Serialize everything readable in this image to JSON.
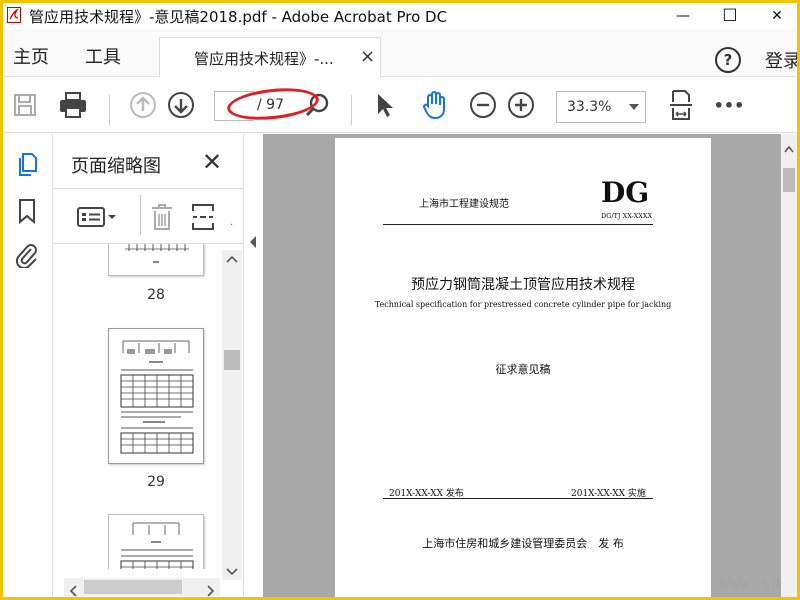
{
  "window": {
    "title": "管应用技术规程》-意见稿2018.pdf - Adobe Acrobat Pro DC",
    "minimize_glyph": "—",
    "maximize_glyph": "☐",
    "close_glyph": "✕"
  },
  "tabs": {
    "home_label": "主页",
    "tools_label": "工具",
    "doc_tab_label": "管应用技术规程》-...",
    "doc_tab_close": "×",
    "help_label": "?",
    "login_label": "登录"
  },
  "toolbar": {
    "page_current": "",
    "page_total": "/ 97",
    "zoom_value": "33.3%",
    "more_label": "•••"
  },
  "thumbnails_panel": {
    "title": "页面缩略图",
    "close_glyph": "✕",
    "pages": [
      {
        "number": "28"
      },
      {
        "number": "29"
      },
      {
        "number": ""
      }
    ]
  },
  "page": {
    "header_left": "上海市工程建设规范",
    "header_logo": "DG",
    "header_code": "DG/TJ XX-XXXX",
    "title_cn": "预应力钢筒混凝土顶管应用技术规程",
    "title_en": "Technical specification for prestressed concrete cylinder pipe for jacking",
    "draft_label": "征求意见稿",
    "issue_date": "201X-XX-XX 发布",
    "effective_date": "201X-XX-XX 实施",
    "publisher": "上海市住房和城乡建设管理委员会　发 布"
  },
  "watermark": "www.cn",
  "colors": {
    "frame": "#f0c400",
    "accent": "#1473e6",
    "annotation": "#e02020",
    "doc_background": "#a8a8a8"
  }
}
